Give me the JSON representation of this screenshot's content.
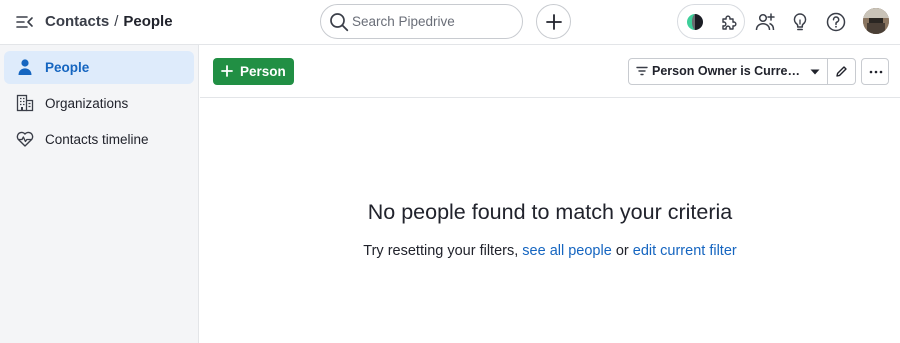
{
  "header": {
    "breadcrumb_parent": "Contacts",
    "breadcrumb_separator": "/",
    "breadcrumb_current": "People",
    "search_placeholder": "Search Pipedrive"
  },
  "icons": {
    "menu_toggle": "menu-collapse-icon",
    "search": "search-icon",
    "add": "plus-icon",
    "app_leaf": "leaf-icon",
    "marketplace": "puzzle-icon",
    "invite": "people-plus-icon",
    "tips": "lightbulb-icon",
    "help": "question-icon",
    "avatar": "user-avatar"
  },
  "sidebar": {
    "items": [
      {
        "label": "People",
        "icon": "person-icon",
        "active": true
      },
      {
        "label": "Organizations",
        "icon": "building-icon",
        "active": false
      },
      {
        "label": "Contacts timeline",
        "icon": "heart-pulse-icon",
        "active": false
      }
    ]
  },
  "toolbar": {
    "add_person_label": "Person",
    "filter_label": "Person Owner is Current user"
  },
  "empty_state": {
    "title": "No people found to match your criteria",
    "prefix": "Try resetting your filters, ",
    "link_all": "see all people",
    "middle": " or ",
    "link_edit": "edit current filter"
  },
  "colors": {
    "accent_blue": "#1565c0",
    "primary_green": "#218f44",
    "sidebar_bg": "#f4f5f7",
    "active_item_bg": "#deebfb"
  }
}
